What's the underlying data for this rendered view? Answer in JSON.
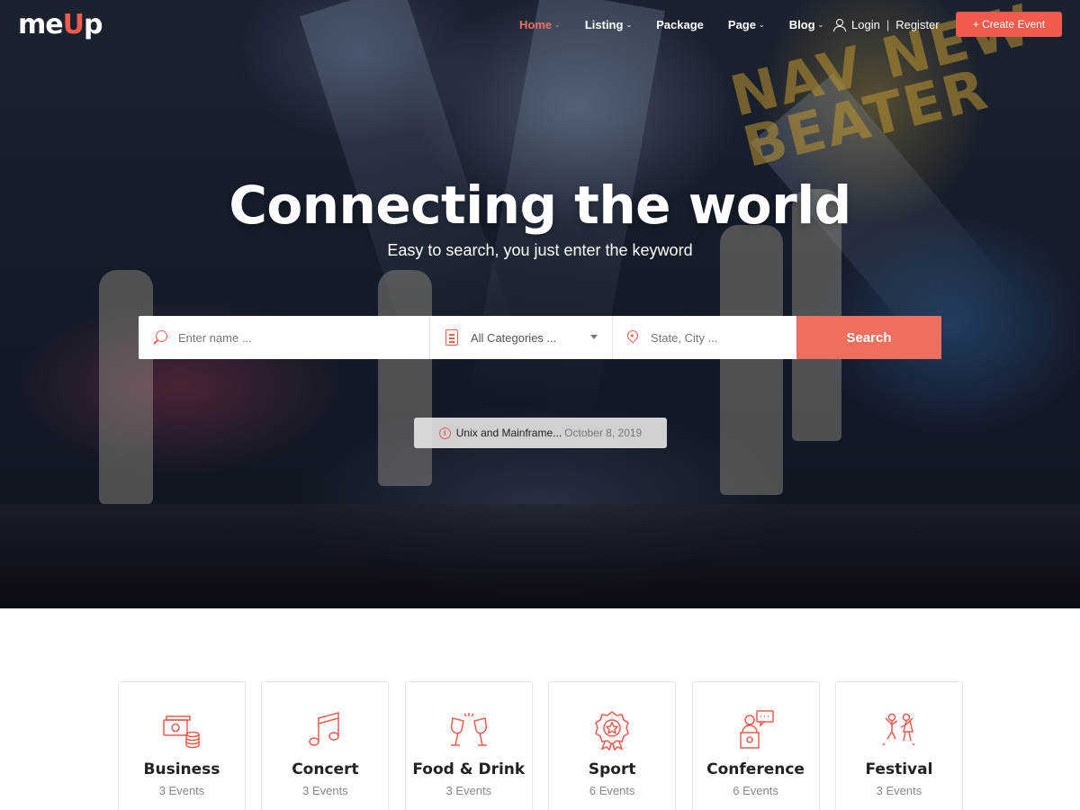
{
  "brand": {
    "logo_pre": "me",
    "logo_accent": "U",
    "logo_post": "p"
  },
  "nav": {
    "items": [
      {
        "label": "Home",
        "caret": "⌄",
        "active": true
      },
      {
        "label": "Listing",
        "caret": "⌄"
      },
      {
        "label": "Package",
        "caret": ""
      },
      {
        "label": "Page",
        "caret": "⌄"
      },
      {
        "label": "Blog",
        "caret": "⌄"
      }
    ],
    "login": "Login",
    "separator": "|",
    "register": "Register",
    "create_button": "+ Create Event"
  },
  "hero": {
    "title": "Connecting the world",
    "subtitle": "Easy to search, you just enter the keyword",
    "backdrop_text": "NAV NEW BEATER"
  },
  "search": {
    "name_placeholder": "Enter name ...",
    "category_value": "All Categories ...",
    "location_placeholder": "State, City ...",
    "button": "Search"
  },
  "notice": {
    "icon": "i",
    "title": "Unix and Mainframe...",
    "date": "October 8, 2019"
  },
  "categories": [
    {
      "name": "Business",
      "count": "3 Events",
      "icon": "money-icon"
    },
    {
      "name": "Concert",
      "count": "3 Events",
      "icon": "music-note-icon"
    },
    {
      "name": "Food & Drink",
      "count": "3 Events",
      "icon": "wine-glasses-icon"
    },
    {
      "name": "Sport",
      "count": "6 Events",
      "icon": "medal-icon"
    },
    {
      "name": "Conference",
      "count": "6 Events",
      "icon": "speaker-podium-icon"
    },
    {
      "name": "Festival",
      "count": "3 Events",
      "icon": "dancing-people-icon"
    }
  ],
  "colors": {
    "accent": "#ef5b4d",
    "search_button": "#ef6f5f"
  }
}
